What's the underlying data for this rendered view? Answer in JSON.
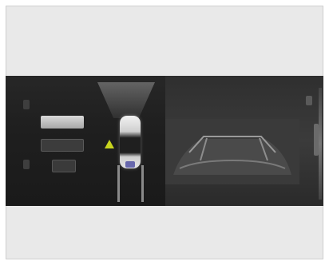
{
  "menu": {
    "button_1": "",
    "button_2": "",
    "button_3": ""
  },
  "colors": {
    "frame": "#e9e9e9",
    "screen": "#1c1c1c",
    "warning": "#c8d41e"
  },
  "icons": {
    "top_left": "gear-icon",
    "bottom_left": "back-icon",
    "top_right": "settings-icon",
    "warning": "warning-icon"
  }
}
